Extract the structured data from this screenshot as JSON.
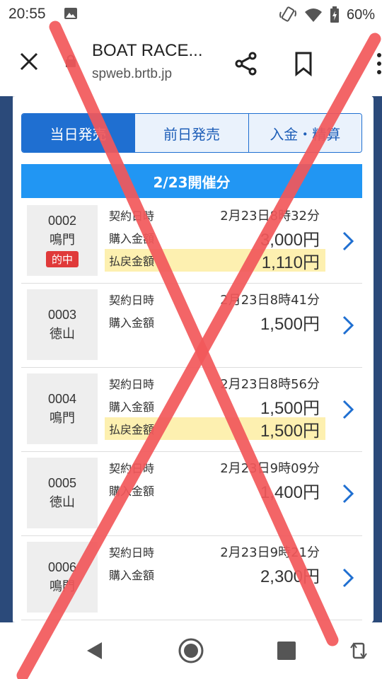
{
  "status_bar": {
    "time": "20:55",
    "battery": "60%",
    "icons": [
      "image-icon",
      "vibrate-icon",
      "wifi-icon",
      "battery-icon"
    ]
  },
  "browser": {
    "title": "BOAT RACE...",
    "url": "spweb.brtb.jp",
    "icons": [
      "close-icon",
      "lock-icon",
      "share-icon",
      "bookmark-icon",
      "more-icon"
    ]
  },
  "tabs": [
    {
      "label": "当日発売",
      "active": true
    },
    {
      "label": "前日発売",
      "active": false
    },
    {
      "label": "入金・精算",
      "active": false
    }
  ],
  "date_header": "2/23開催分",
  "labels": {
    "contract": "契約日時",
    "purchase": "購入金額",
    "payout": "払戻金額"
  },
  "rows": [
    {
      "num": "0002",
      "venue": "鳴門",
      "hit": "的中",
      "date": "2月23日8時32分",
      "purchase": "3,000円",
      "payout": "1,110円"
    },
    {
      "num": "0003",
      "venue": "徳山",
      "hit": "",
      "date": "2月23日8時41分",
      "purchase": "1,500円",
      "payout": ""
    },
    {
      "num": "0004",
      "venue": "鳴門",
      "hit": "",
      "date": "2月23日8時56分",
      "purchase": "1,500円",
      "payout": "1,500円"
    },
    {
      "num": "0005",
      "venue": "徳山",
      "hit": "",
      "date": "2月23日9時09分",
      "purchase": "1,400円",
      "payout": ""
    },
    {
      "num": "0006",
      "venue": "鳴門",
      "hit": "",
      "date": "2月23日9時21分",
      "purchase": "2,300円",
      "payout": ""
    }
  ],
  "colors": {
    "accent": "#1f6fd1",
    "header_blue": "#2196f3",
    "hit_red": "#e03a3a",
    "payout_bg": "#fdf0b0",
    "overlay_red": "#f2585b"
  },
  "nav_icons": [
    "back-icon",
    "home-icon",
    "recent-apps-icon",
    "rotate-icon"
  ]
}
